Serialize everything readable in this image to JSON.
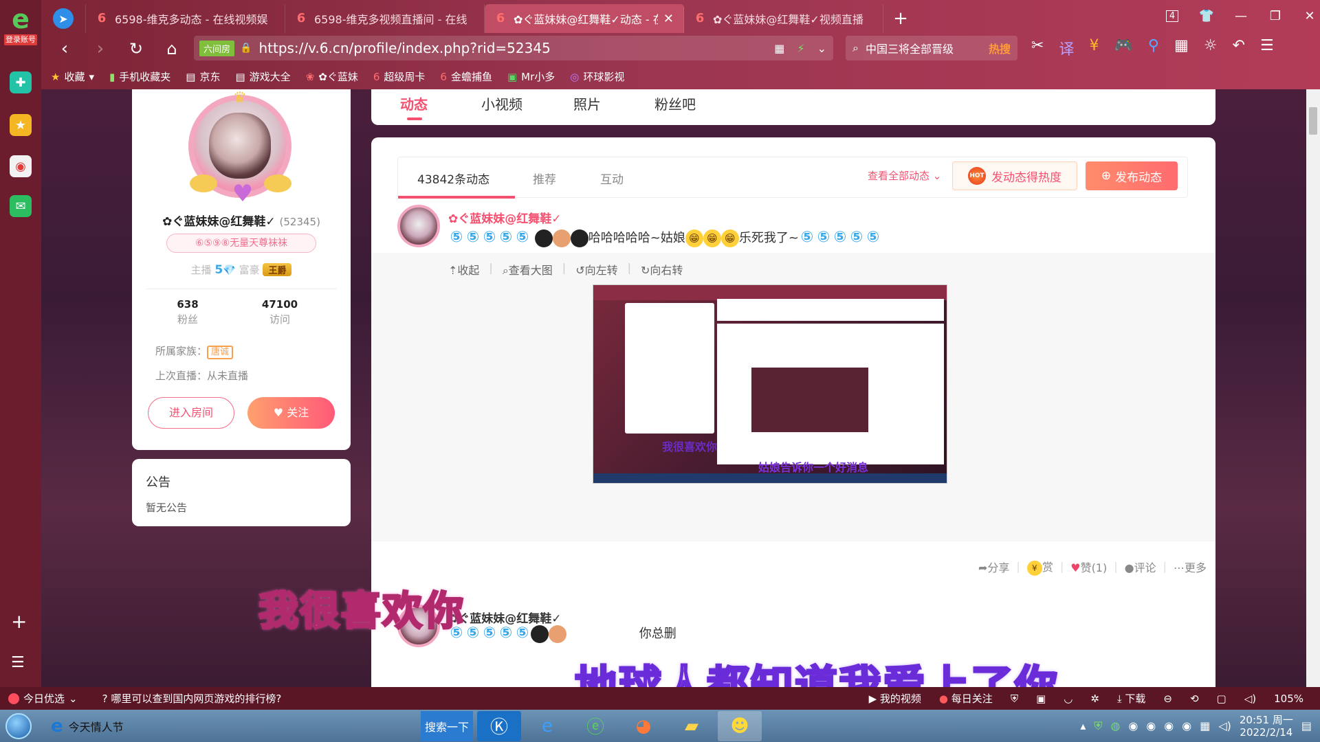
{
  "browser": {
    "tabs": [
      {
        "label": "6598-维克多动态 - 在线视频娱",
        "active": false
      },
      {
        "label": "6598-维克多视频直播间 - 在线",
        "active": false
      },
      {
        "label": "✿ぐ蓝妹妹@红舞鞋✓动态 - 在",
        "active": true
      },
      {
        "label": "✿ぐ蓝妹妹@红舞鞋✓视频直播",
        "active": false
      }
    ],
    "new_tab": "+",
    "tab_count": "4",
    "address": {
      "badge": "六间房",
      "url": "https://v.6.cn/profile/index.php?rid=52345"
    },
    "search": {
      "placeholder": "中国三将全部晋级",
      "hot": "热搜"
    },
    "login_label": "登录账号",
    "bookmarks": [
      {
        "icon": "★",
        "label": "收藏"
      },
      {
        "icon": "▮",
        "label": "手机收藏夹"
      },
      {
        "icon": "▤",
        "label": "京东"
      },
      {
        "icon": "▤",
        "label": "游戏大全"
      },
      {
        "icon": "❀",
        "label": "✿ぐ蓝妹"
      },
      {
        "icon": "6",
        "label": "超级周卡"
      },
      {
        "icon": "6",
        "label": "金蟾捕鱼"
      },
      {
        "icon": "▣",
        "label": "Mr小多"
      },
      {
        "icon": "◎",
        "label": "环球影视"
      }
    ]
  },
  "profile": {
    "name": "✿ぐ蓝妹妹@红舞鞋✓",
    "uid": "(52345)",
    "rank": "⑥⑤⑨⑧无量天尊袜袜",
    "host_label": "主播",
    "host_level": "5",
    "rich_label": "富豪",
    "rich_title": "王爵",
    "fans_num": "638",
    "fans_label": "粉丝",
    "visits_num": "47100",
    "visits_label": "访问",
    "family_label": "所属家族：",
    "family_tag": "唐诚",
    "last_live": "上次直播：从未直播",
    "enter_room": "进入房间",
    "follow": "关注"
  },
  "notice": {
    "title": "公告",
    "body": "暂无公告"
  },
  "profile_tabs": [
    "动态",
    "小视频",
    "照片",
    "粉丝吧"
  ],
  "feed": {
    "tabs": [
      "43842条动态",
      "推荐",
      "互动"
    ],
    "view_all": "查看全部动态",
    "hot_label": "发动态得热度",
    "hot_icon_text": "HOT",
    "post_label": "发布动态",
    "post1": {
      "author": "✿ぐ蓝妹妹@红舞鞋✓",
      "text_middle": "哈哈哈哈哈~姑娘",
      "text_end": "乐死我了~"
    },
    "image_tools": [
      "收起",
      "查看大图",
      "向左转",
      "向右转"
    ],
    "screenshot_captions": [
      "我很喜欢你",
      "姑娘告诉你一个好消息"
    ],
    "actions": {
      "share": "分享",
      "reward": "赏",
      "like": "赞(1)",
      "comment": "评论",
      "more": "更多"
    },
    "post2": {
      "author": "✿ぐ蓝妹妹@红舞鞋✓",
      "text": "你总删"
    }
  },
  "subtitles": [
    "我很喜欢你",
    "地球人都知道我爱上了你"
  ],
  "statusbar": {
    "today": "今日优选",
    "question": "哪里可以查到国内网页游戏的排行榜?",
    "items": [
      "我的视频",
      "每日关注",
      "下载",
      "105%"
    ]
  },
  "taskbar": {
    "ie_label": "今天情人节",
    "search_label": "搜索一下",
    "time": "20:51 周一",
    "date": "2022/2/14"
  }
}
